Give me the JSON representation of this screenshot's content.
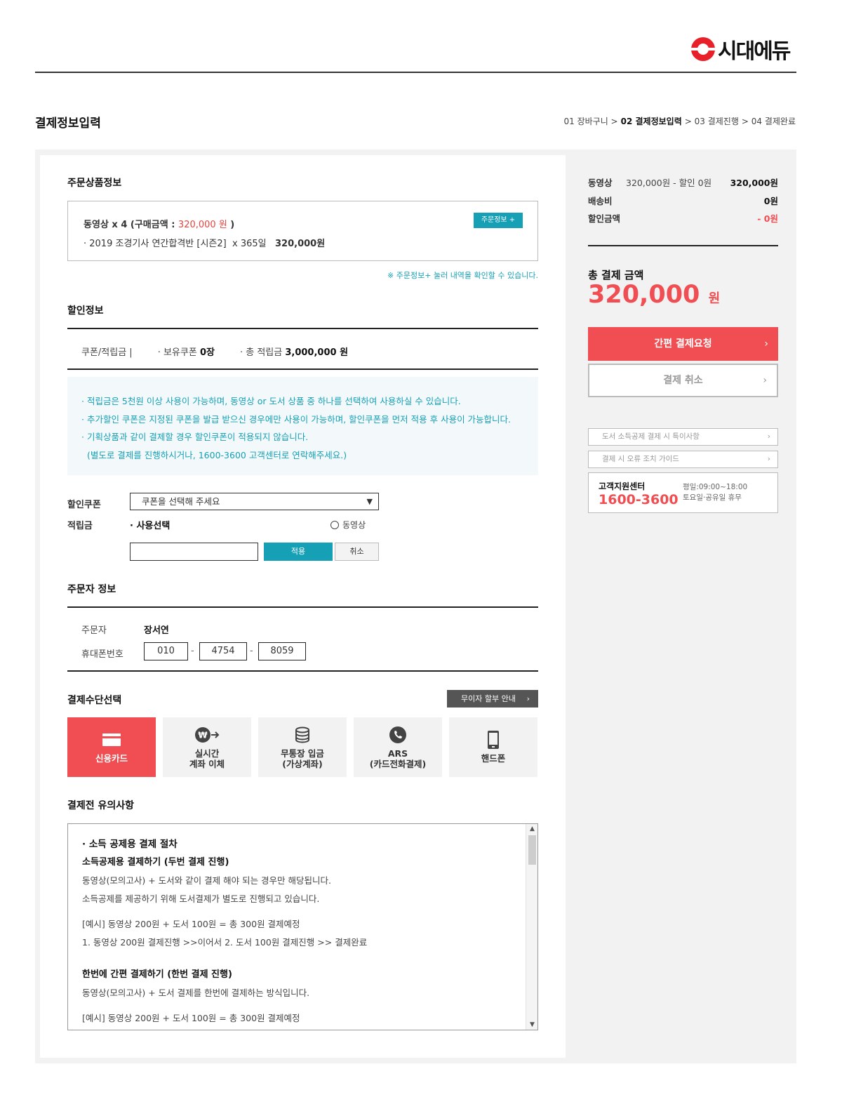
{
  "brand": {
    "name": "시대에듀"
  },
  "page_title": "결제정보입력",
  "steps": [
    {
      "label": "01 장바구니 >",
      "current": false
    },
    {
      "label": "02 결제정보입력",
      "current": true
    },
    {
      "label": "> 03 결제진행",
      "current": false
    },
    {
      "label": "> 04 결제완료",
      "current": false
    }
  ],
  "order_info": {
    "title": "주문상품정보",
    "summary_prefix": "동영상 x 4 (구매금액 : ",
    "summary_amount": "320,000 원",
    "summary_suffix": " )",
    "item_name": "· 2019 조경기사 연간합격반 [시즌2]",
    "item_days": "x 365일",
    "item_price": "320,000원",
    "order_info_button": "주문정보 +",
    "notice": "※ 주문정보+ 눌러 내역을 확인할 수 있습니다."
  },
  "discount": {
    "title": "할인정보",
    "coupon_point_label": "쿠폰/적립금 |",
    "owned_coupon_label": "· 보유쿠폰",
    "owned_coupon_value": "0장",
    "total_point_label": "· 총 적립금",
    "total_point_value": "3,000,000 원",
    "notices": [
      "· 적립금은 5천원 이상 사용이 가능하며, 동영상 or 도서 상품 중 하나를 선택하여 사용하실 수 있습니다.",
      "· 추가할인 쿠폰은 지정된 쿠폰을 발급 받으신 경우에만 사용이 가능하며, 할인쿠폰을 먼저 적용 후 사용이 가능합니다.",
      "· 기획상품과 같이 결제할 경우 할인쿠폰이 적용되지 않습니다.",
      "  (별도로 결제를 진행하시거나, 1600-3600 고객센터로 연락해주세요.)"
    ],
    "coupon_label": "할인쿠폰",
    "coupon_select": "쿠폰을 선택해 주세요",
    "point_label": "적립금",
    "use_select_label": "· 사용선택",
    "radio_video": "동영상",
    "apply_button": "적용",
    "cancel_button": "취소"
  },
  "orderer": {
    "title": "주문자 정보",
    "name_label": "주문자",
    "name_value": "장서연",
    "phone_label": "휴대폰번호",
    "phone": [
      "010",
      "4754",
      "8059"
    ]
  },
  "payment": {
    "title": "결제수단선택",
    "installment_button": "무이자 할부 안내",
    "methods": [
      {
        "line1": "신용카드",
        "line2": "",
        "icon": "credit-card-icon",
        "active": true
      },
      {
        "line1": "실시간",
        "line2": "계좌 이체",
        "icon": "won-transfer-icon",
        "active": false
      },
      {
        "line1": "무통장 입금",
        "line2": "(가상계좌)",
        "icon": "coin-stack-icon",
        "active": false
      },
      {
        "line1": "ARS",
        "line2": "(카드전화결제)",
        "icon": "phone-icon",
        "active": false
      },
      {
        "line1": "핸드폰",
        "line2": "",
        "icon": "mobile-icon",
        "active": false
      }
    ]
  },
  "terms": {
    "title": "결제전 유의사항",
    "bullet": "· 소득 공제용 결제 절차",
    "head1": "소득공제용 결제하기 (두번 결제 진행)",
    "line1": "동영상(모의고사) + 도서와 같이 결제 해야 되는 경우만 해당됩니다.",
    "line2": "소득공제를 제공하기 위해 도서결제가 별도로 진행되고 있습니다.",
    "line3": "[예시] 동영상 200원 + 도서 100원 = 총 300원 결제예정",
    "line4": "1. 동영상 200원 결제진행 >>이어서 2. 도서 100원 결제진행 >> 결제완료",
    "head2": "한번에 간편 결제하기 (한번 결제 진행)",
    "line5": "동영상(모의고사) + 도서 결제를 한번에 결제하는 방식입니다.",
    "line6": "[예시] 동영상 200원 + 도서 100원 = 총 300원 결제예정"
  },
  "summary": {
    "video_label": "동영상",
    "video_detail": "320,000원 - 할인 0원",
    "video_value": "320,000원",
    "shipping_label": "배송비",
    "shipping_value": "0원",
    "discount_label": "할인금액",
    "discount_value": "- 0원",
    "total_label": "총 결제 금액",
    "total_amount": "320,000",
    "total_unit": "원",
    "pay_button": "간편 결제요청",
    "cancel_button": "결제 취소",
    "link1": "도서 소득공제 결제 시 특이사항",
    "link2": "결제 시 오류 조치 가이드",
    "cs_title": "고객지원센터",
    "cs_phone": "1600-3600",
    "cs_hours1": "평일:09:00~18:00",
    "cs_hours2": "토요일·공유일 휴무"
  },
  "colors": {
    "accent": "#f04e52",
    "teal": "#15a0b6"
  }
}
